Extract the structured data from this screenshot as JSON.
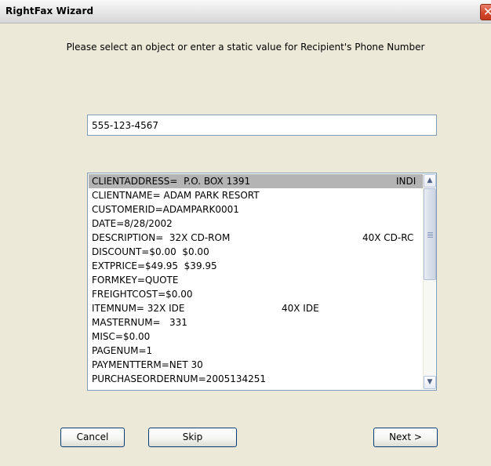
{
  "window": {
    "title": "RightFax Wizard",
    "close_glyph": "✕"
  },
  "prompt": "Please select an object or enter a static value for Recipient's Phone Number",
  "value_input": {
    "value": "555-123-4567"
  },
  "list": {
    "selected_index": 0,
    "items": [
      {
        "label": "CLIENTADDRESS=  P.O. BOX 1391",
        "extra": "INDI"
      },
      {
        "label": "CLIENTNAME= ADAM PARK RESORT",
        "extra": ""
      },
      {
        "label": "CUSTOMERID=ADAMPARK0001",
        "extra": ""
      },
      {
        "label": "DATE=8/28/2002",
        "extra": ""
      },
      {
        "label": "DESCRIPTION=  32X CD-ROM",
        "extra": "40X CD-RC"
      },
      {
        "label": "DISCOUNT=$0.00  $0.00",
        "extra": ""
      },
      {
        "label": "EXTPRICE=$49.95  $39.95",
        "extra": ""
      },
      {
        "label": "FORMKEY=QUOTE",
        "extra": ""
      },
      {
        "label": "FREIGHTCOST=$0.00",
        "extra": ""
      },
      {
        "label": "ITEMNUM= 32X IDE",
        "extra": "40X IDE"
      },
      {
        "label": "MASTERNUM=   331",
        "extra": ""
      },
      {
        "label": "MISC=$0.00",
        "extra": ""
      },
      {
        "label": "PAGENUM=1",
        "extra": ""
      },
      {
        "label": "PAYMENTTERM=NET 30",
        "extra": ""
      },
      {
        "label": "PURCHASEORDERNUM=2005134251",
        "extra": ""
      }
    ]
  },
  "scrollbar": {
    "up_icon": "▲",
    "down_icon": "▼"
  },
  "buttons": {
    "cancel": "Cancel",
    "skip": "Skip",
    "next": "Next >"
  }
}
